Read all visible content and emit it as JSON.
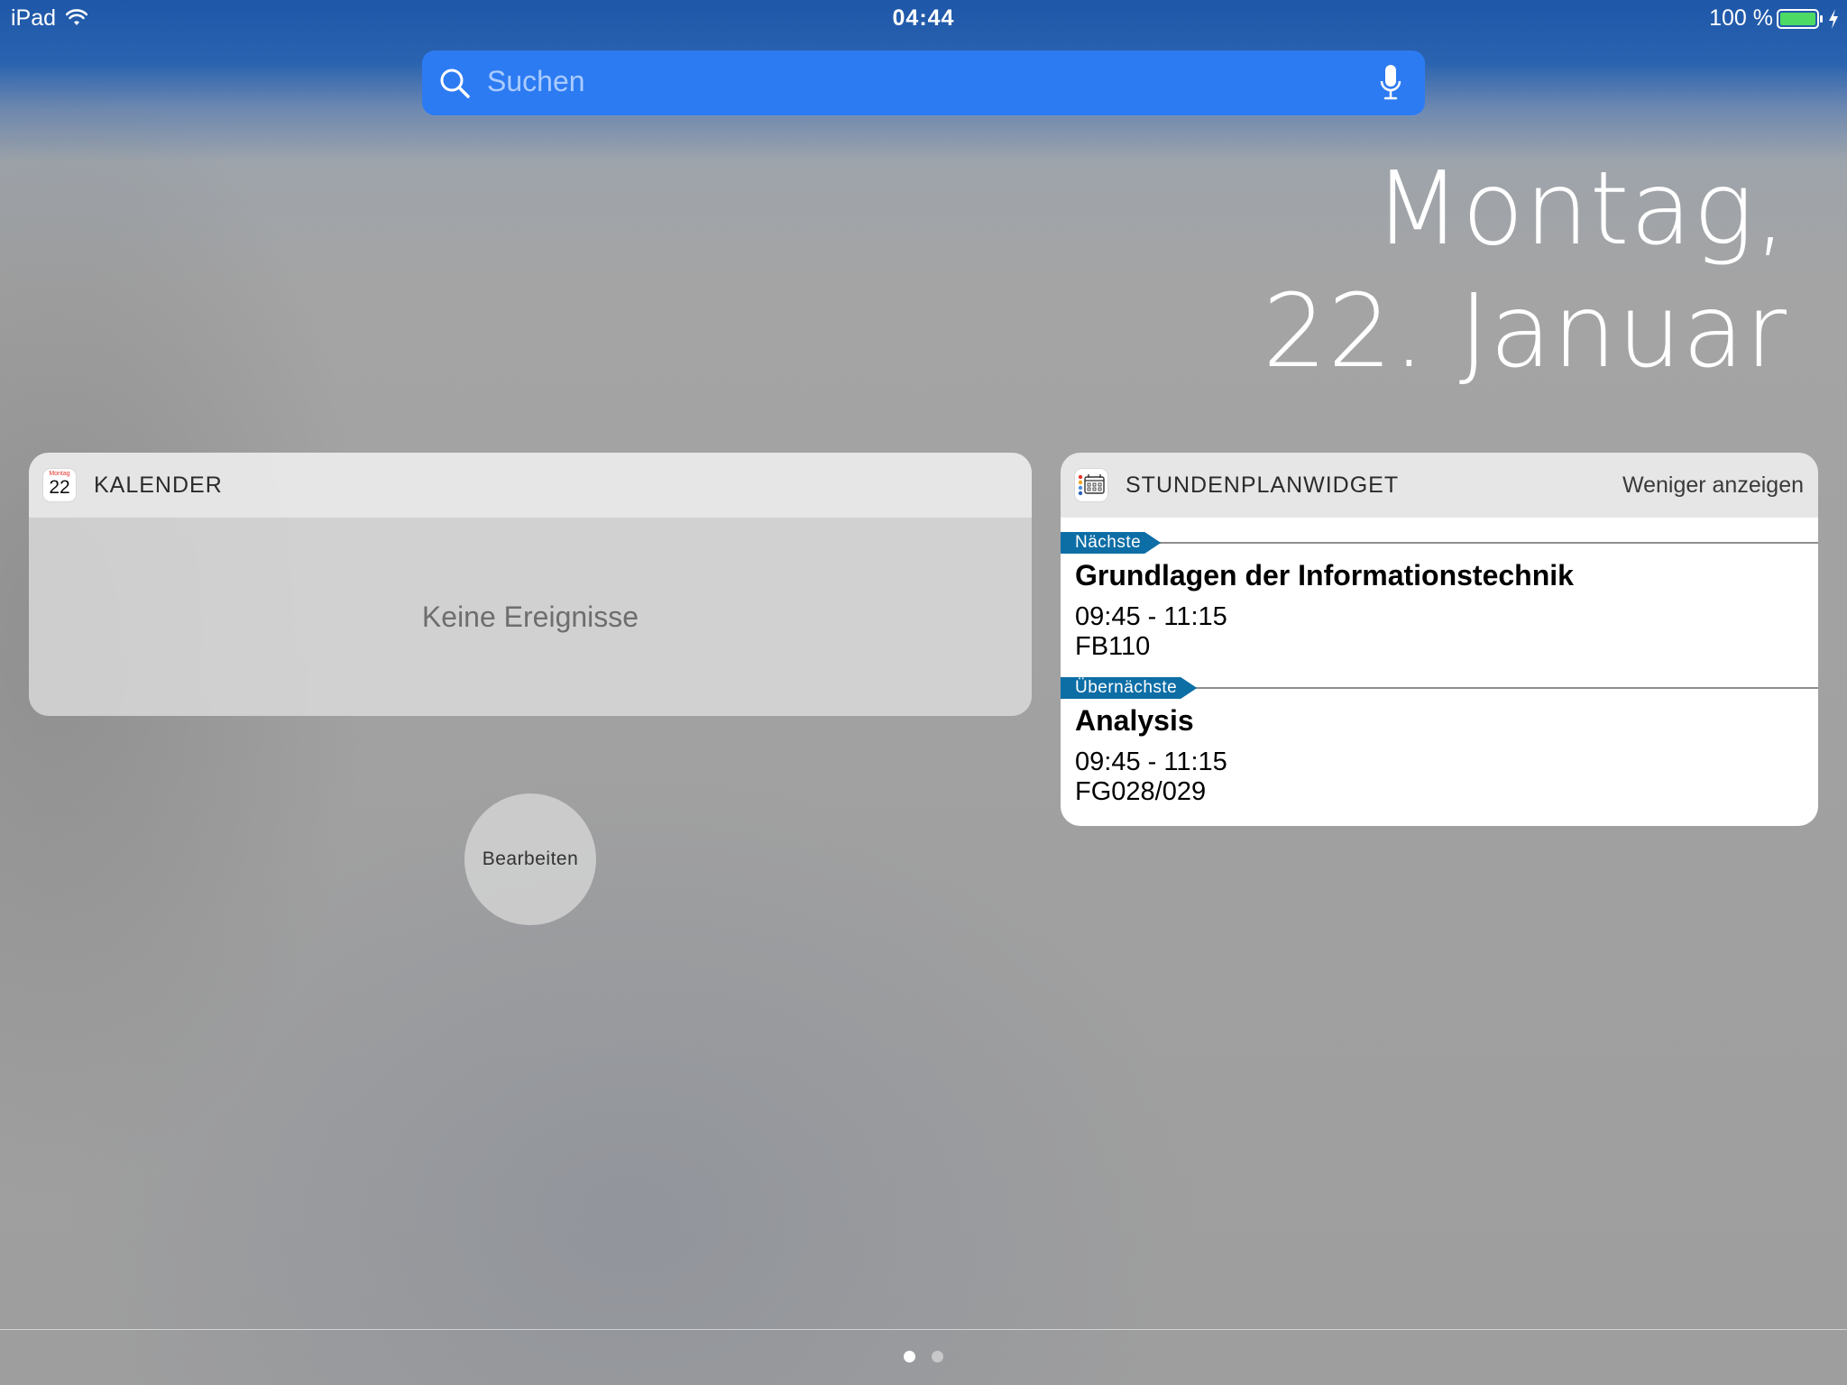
{
  "status_bar": {
    "device": "iPad",
    "time": "04:44",
    "battery_percent": "100 %",
    "icons": [
      "wifi-icon",
      "battery-icon",
      "charging-bolt-icon"
    ]
  },
  "search": {
    "placeholder": "Suchen",
    "icons": [
      "search-icon",
      "microphone-icon"
    ]
  },
  "date": {
    "line1": "Montag,",
    "line2": "22. Januar"
  },
  "calendar_widget": {
    "title": "KALENDER",
    "icon": {
      "name": "calendar-app-icon",
      "weekday": "Montag",
      "day": "22"
    },
    "empty_text": "Keine Ereignisse"
  },
  "edit_button": {
    "label": "Bearbeiten"
  },
  "timetable_widget": {
    "title": "STUNDENPLANWIDGET",
    "icon": "timetable-app-icon",
    "toggle_label": "Weniger anzeigen",
    "entries": [
      {
        "tag": "Nächste",
        "title": "Grundlagen der Informationstechnik",
        "time": "09:45 - 11:15",
        "room": "FB110"
      },
      {
        "tag": "Übernächste",
        "title": "Analysis",
        "time": "09:45 - 11:15",
        "room": "FG028/029"
      }
    ],
    "accent_color": "#0d6ea6"
  },
  "page_indicator": {
    "pages": 2,
    "current": 1
  }
}
